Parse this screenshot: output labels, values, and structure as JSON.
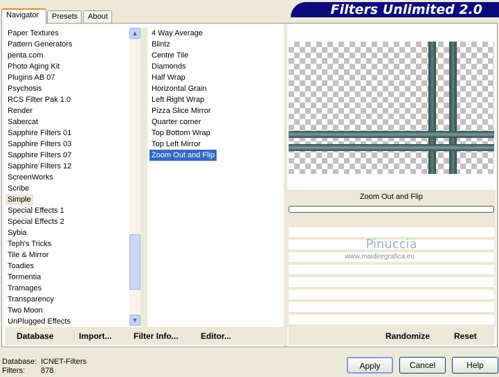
{
  "banner": "Filters Unlimited 2.0",
  "tabs": [
    "Navigator",
    "Presets",
    "About"
  ],
  "categories": [
    "Paper Textures",
    "Pattern Generators",
    "penta.com",
    "Photo Aging Kit",
    "Plugins AB 07",
    "Psychosis",
    "RCS Filter Pak 1.0",
    "Render",
    "Sabercat",
    "Sapphire Filters 01",
    "Sapphire Filters 03",
    "Sapphire Filters 07",
    "Sapphire Filters 12",
    "ScreenWorks",
    "Scribe",
    "Simple",
    "Special Effects 1",
    "Special Effects 2",
    "Sybia",
    "Teph's Tricks",
    "Tile & Mirror",
    "Toadies",
    "Tormentia",
    "Tramages",
    "Transparency",
    "Two Moon",
    "UnPlugged Effects"
  ],
  "current_category": "Simple",
  "filters": [
    "4 Way Average",
    "Blintz",
    "Centre Tile",
    "Diamonds",
    "Half Wrap",
    "Horizontal Grain",
    "Left Right Wrap",
    "Pizza Slice Mirror",
    "Quarter corner",
    "Top Bottom Wrap",
    "Top Left Mirror",
    "Zoom Out and Flip"
  ],
  "selected_filter": "Zoom Out and Flip",
  "preview_label": "Zoom Out and Flip",
  "watermark": {
    "name": "Pinuccia",
    "url": "www.maidiregrafica.eu"
  },
  "nav_buttons": {
    "database": "Database",
    "import": "Import...",
    "filter_info": "Filter Info...",
    "editor": "Editor..."
  },
  "param_buttons": {
    "randomize": "Randomize",
    "reset": "Reset"
  },
  "status": {
    "database_label": "Database:",
    "database_value": "ICNET-Filters",
    "filters_label": "Filters:",
    "filters_value": "878"
  },
  "dialog_buttons": {
    "apply": "Apply",
    "cancel": "Cancel",
    "help": "Help"
  },
  "colors": {
    "banner": "#0a0a7c",
    "selection": "#316ac5",
    "bars": "#2f4d52"
  }
}
